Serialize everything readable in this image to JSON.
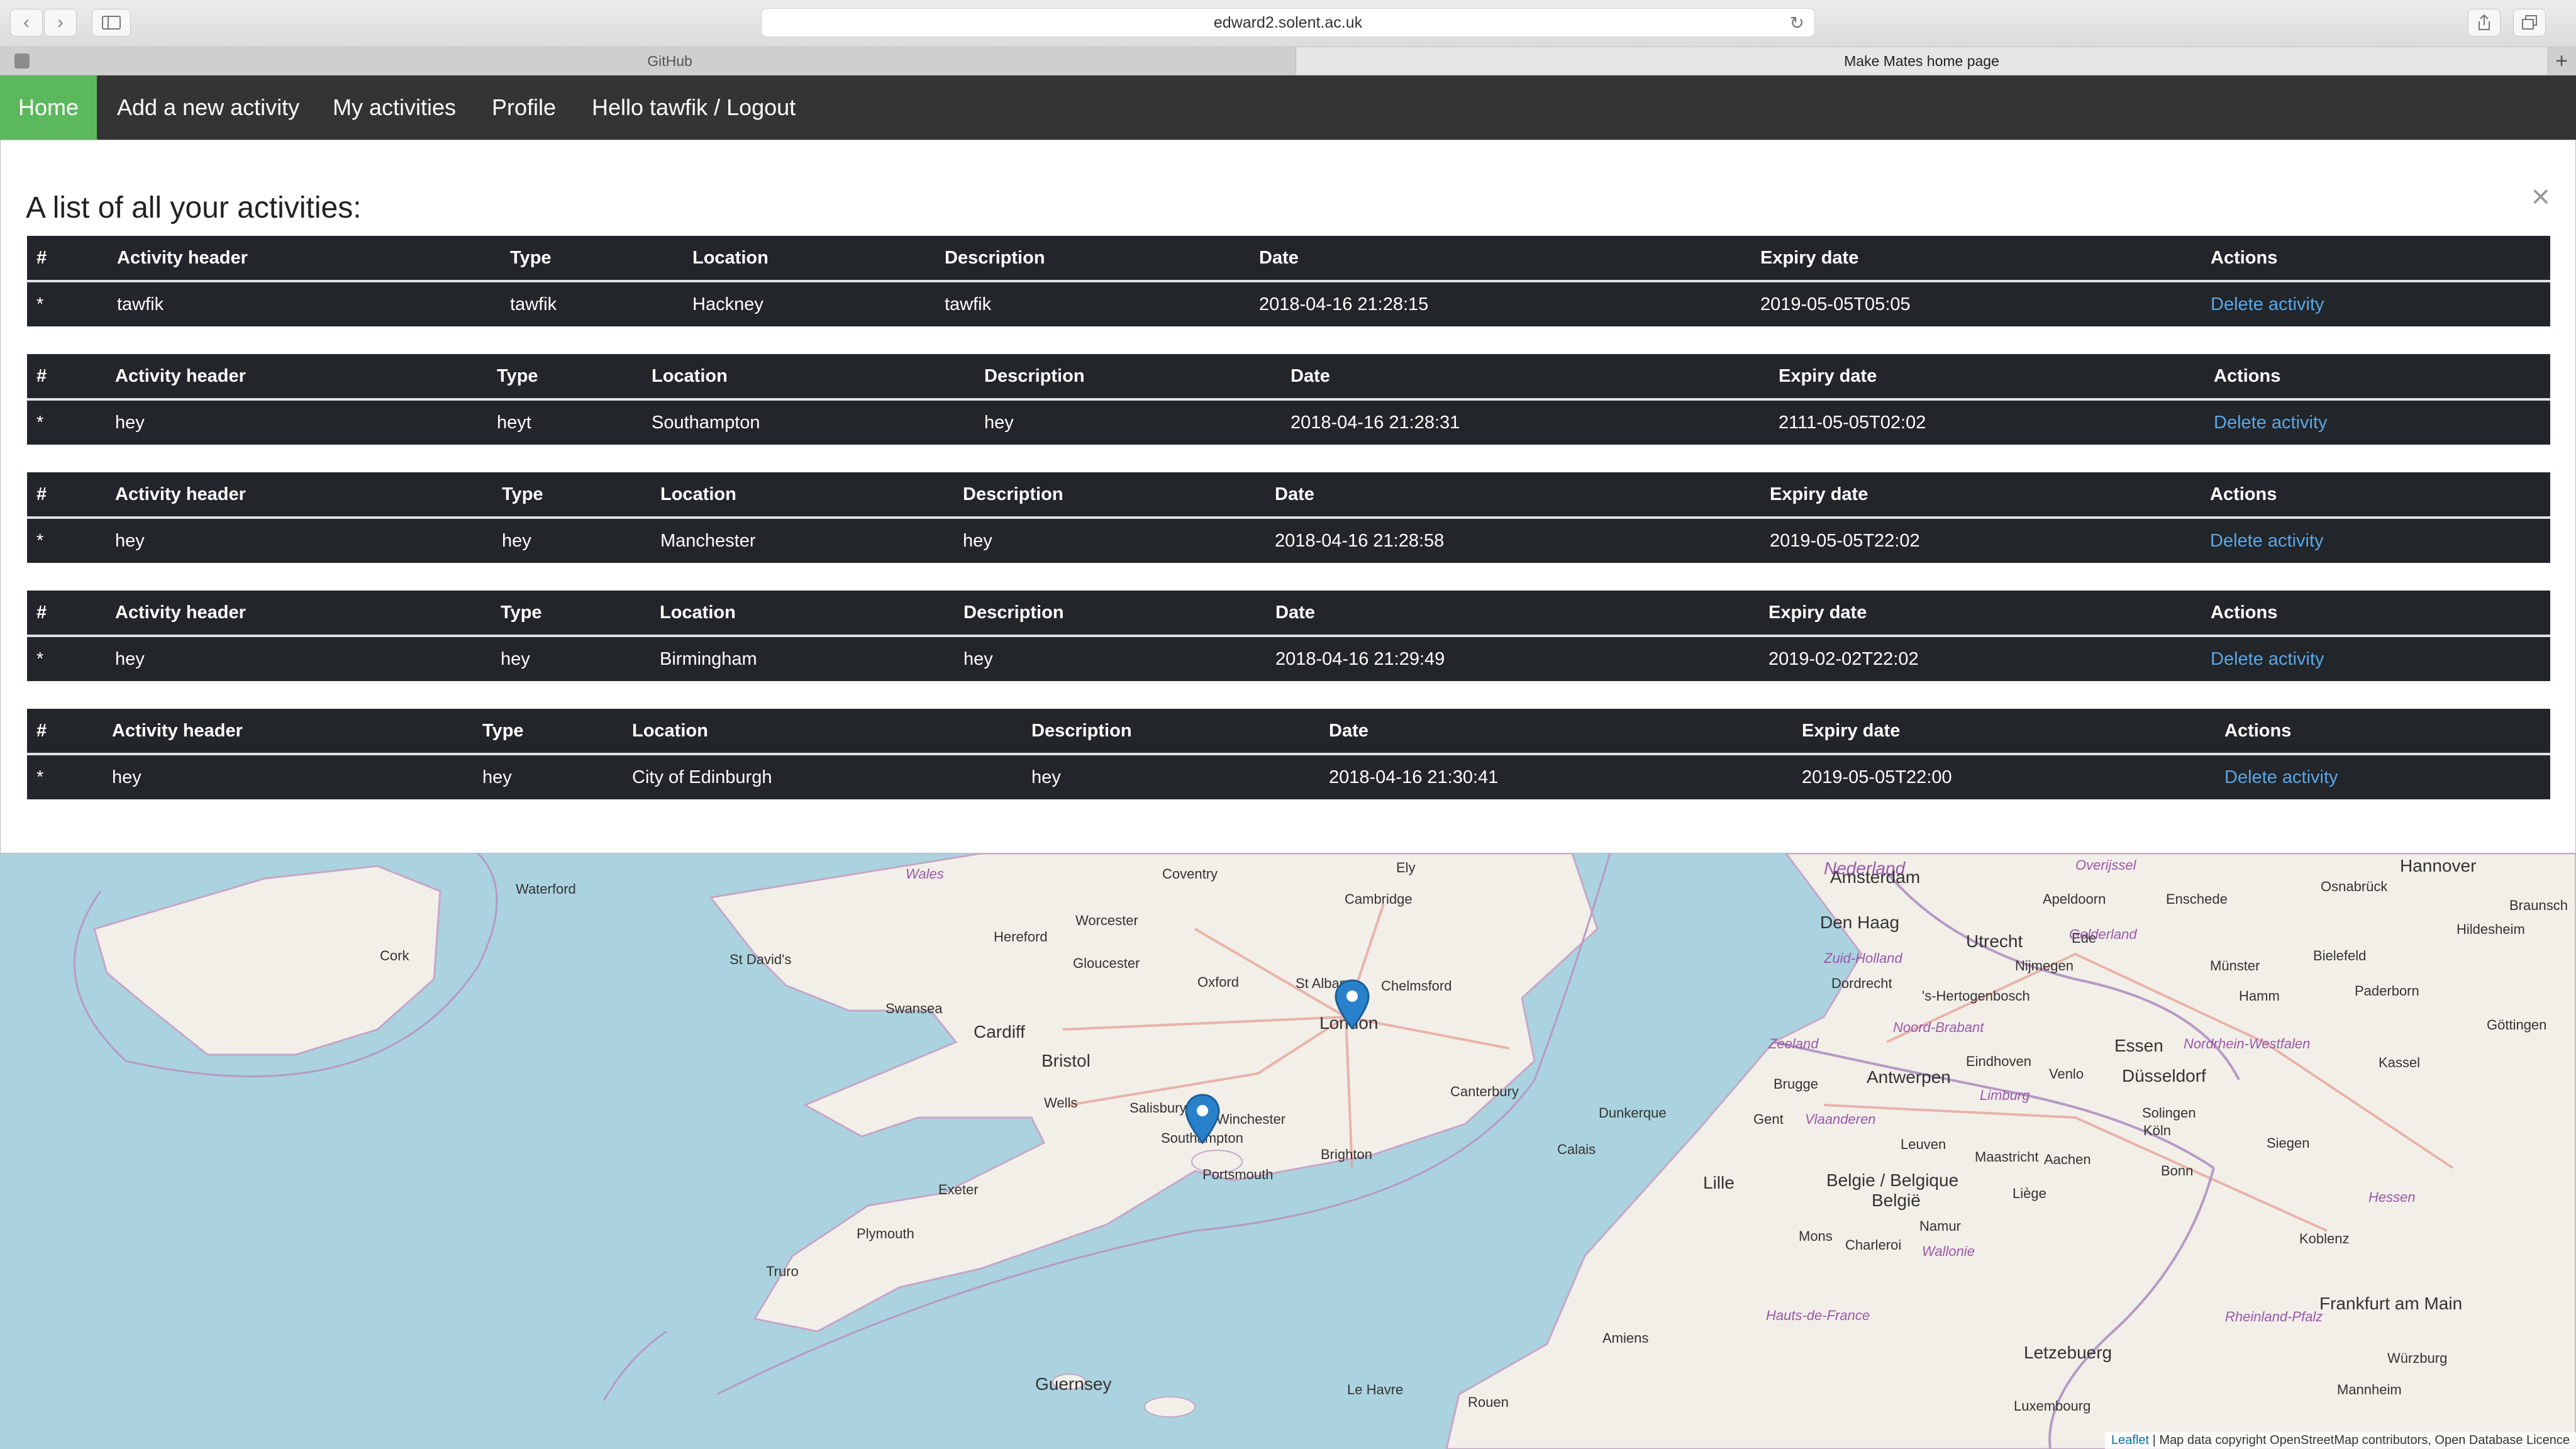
{
  "browser": {
    "url": "edward2.solent.ac.uk",
    "tabs": [
      {
        "label": "GitHub"
      },
      {
        "label": "Make Mates home page"
      }
    ]
  },
  "nav": {
    "items": [
      {
        "label": "Home"
      },
      {
        "label": "Add a new activity"
      },
      {
        "label": "My activities"
      },
      {
        "label": "Profile"
      },
      {
        "label": "Hello tawfik / Logout"
      }
    ]
  },
  "panel": {
    "heading": "A list of all your activities:",
    "close": "×"
  },
  "table": {
    "headers": [
      "#",
      "Activity header",
      "Type",
      "Location",
      "Description",
      "Date",
      "Expiry date",
      "Actions"
    ],
    "action_label": "Delete activity"
  },
  "activities": [
    {
      "num": "*",
      "header": "tawfik",
      "type": "tawfik",
      "location": "Hackney",
      "description": "tawfik",
      "date": "2018-04-16 21:28:15",
      "expiry": "2019-05-05T05:05"
    },
    {
      "num": "*",
      "header": "hey",
      "type": "heyt",
      "location": "Southampton",
      "description": "hey",
      "date": "2018-04-16 21:28:31",
      "expiry": "2111-05-05T02:02"
    },
    {
      "num": "*",
      "header": "hey",
      "type": "hey",
      "location": "Manchester",
      "description": "hey",
      "date": "2018-04-16 21:28:58",
      "expiry": "2019-05-05T22:02"
    },
    {
      "num": "*",
      "header": "hey",
      "type": "hey",
      "location": "Birmingham",
      "description": "hey",
      "date": "2018-04-16 21:29:49",
      "expiry": "2019-02-02T22:02"
    },
    {
      "num": "*",
      "header": "hey",
      "type": "hey",
      "location": "City of Edinburgh",
      "description": "hey",
      "date": "2018-04-16 21:30:41",
      "expiry": "2019-05-05T22:00"
    }
  ],
  "map": {
    "labels": [
      "Wales",
      "Coventry",
      "Ely",
      "Nederland",
      "Overijssel",
      "Hannover",
      "Waterford",
      "Cambridge",
      "Amsterdam",
      "Den Haag",
      "Utrecht",
      "Ede",
      "Apeldoorn",
      "Enschede",
      "Osnabrück",
      "Braunsch",
      "Hereford",
      "Worcester",
      "Zuid-Holland",
      "Gelderland",
      "Hildesheim",
      "Cork",
      "St David's",
      "Gloucester",
      "Dordrecht",
      "Nijmegen",
      "Bielefeld",
      "Swansea",
      "Oxford",
      "St Albans",
      "Chelmsford",
      "'s-Hertogenbosch",
      "Münster",
      "Hamm",
      "Paderborn",
      "Cardiff",
      "London",
      "Noord-Brabant",
      "Göttingen",
      "Bristol",
      "Zeeland",
      "Eindhoven",
      "Essen",
      "Nordrhein-Westfalen",
      "Canterbury",
      "Brugge",
      "Antwerpen",
      "Venlo",
      "Düsseldorf",
      "Kassel",
      "Salisbury",
      "Winchester",
      "Wells",
      "Limburg",
      "Southampton",
      "Gent",
      "Vlaanderen",
      "Solingen",
      "Dunkerque",
      "Portsmouth",
      "Brighton",
      "Leuven",
      "Maastricht",
      "Köln",
      "Siegen",
      "Calais",
      "Aachen",
      "Lille",
      "Belgie / Belgique",
      "België",
      "Bonn",
      "Exeter",
      "Liège",
      "Hessen",
      "Plymouth",
      "Namur",
      "Mons",
      "Wallonie",
      "Koblenz",
      "Charleroi",
      "Truro",
      "Hauts-de-France",
      "Frankfurt am Main",
      "Amiens",
      "Rheinland-Pfalz",
      "Guernsey",
      "Letzebuerg",
      "Würzburg",
      "Le Havre",
      "Rouen",
      "Mannheim",
      "Luxembourg"
    ],
    "attribution_link": "Leaflet",
    "attribution_text": " | Map data copyright OpenStreetMap contributors, Open Database Licence"
  },
  "colors": {
    "nav_bg": "#343434",
    "nav_active": "#5cb85c",
    "table_bg": "#222529",
    "link": "#5aa7e6",
    "sea": "#aad3df",
    "land": "#f2efe9",
    "marker": "#2a81cb"
  }
}
